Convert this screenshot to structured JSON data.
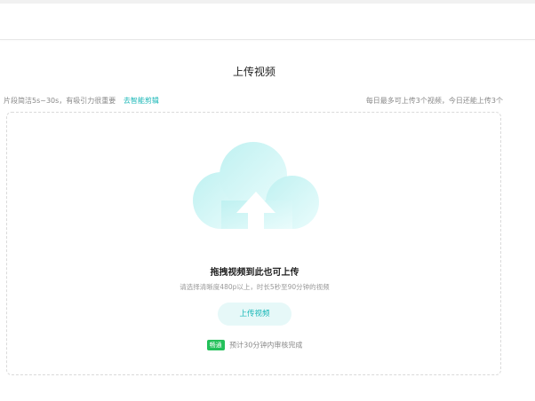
{
  "page": {
    "title": "上传视频"
  },
  "hints": {
    "left_text": "片段简洁5s~30s，有吸引力很重要",
    "left_link": "去智能剪辑",
    "right_text": "每日最多可上传3个视频，今日还能上传3个"
  },
  "upload": {
    "drag_title": "拖拽视频到此也可上传",
    "requirement": "请选择清晰度480p以上，时长5秒至90分钟的视频",
    "button_label": "上传视频",
    "review_badge": "畅通",
    "review_text": "预计30分钟内审核完成"
  },
  "colors": {
    "accent": "#19b7b7",
    "badge": "#23c05a",
    "cloud_light": "#e6fbfb",
    "cloud_mid": "#bff1f1"
  },
  "icons": {
    "upload": "cloud-upload-icon"
  }
}
